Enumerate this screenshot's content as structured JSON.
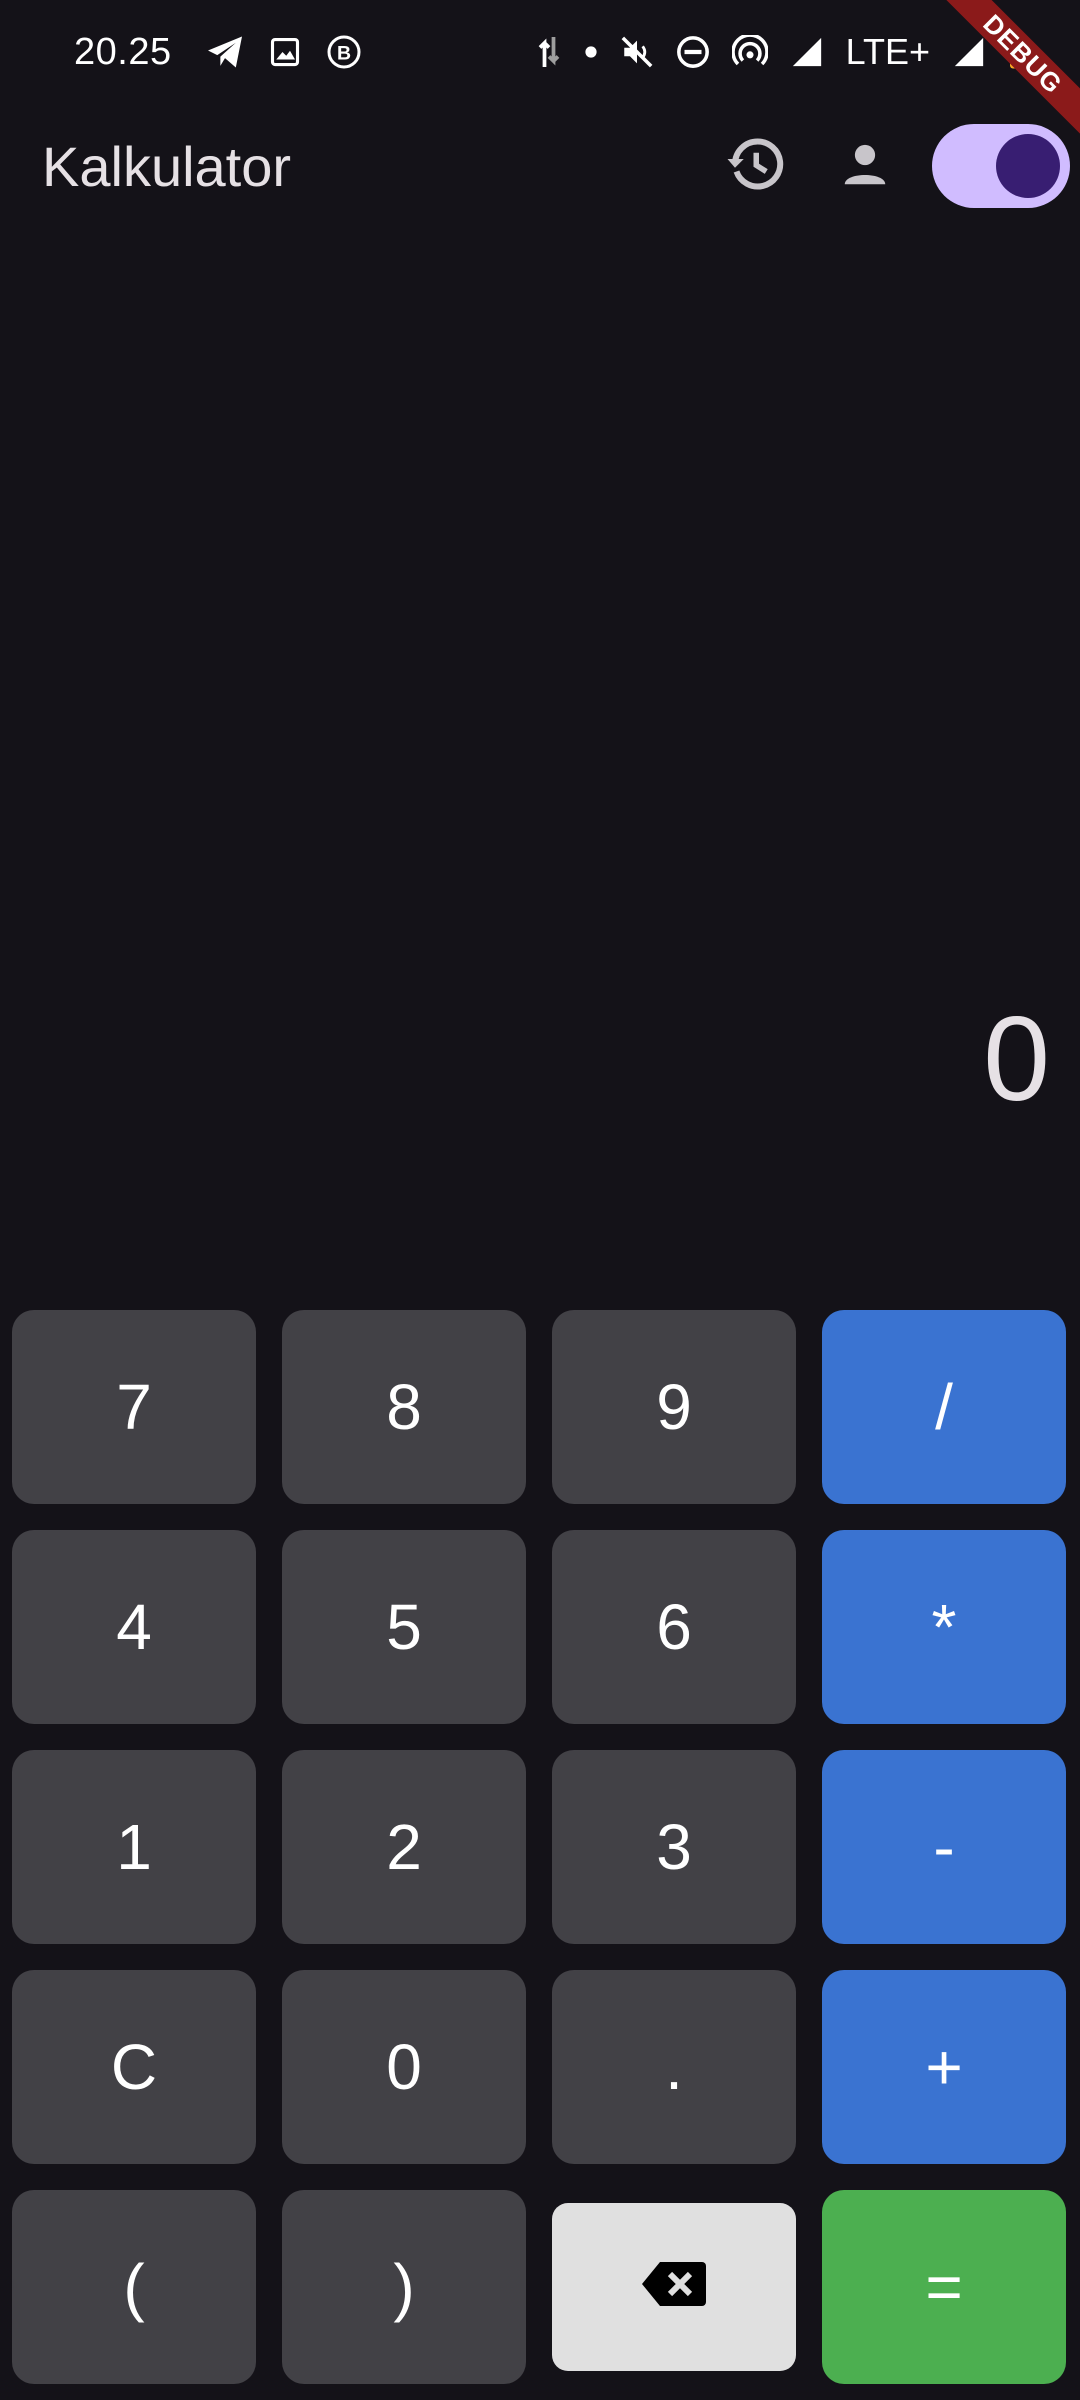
{
  "status_bar": {
    "time": "20.25",
    "network": "LTE+",
    "icons": [
      "telegram-icon",
      "gallery-icon",
      "b-badge-icon",
      "data-arrows-icon",
      "dot-icon",
      "mute-icon",
      "dnd-icon",
      "hotspot-icon",
      "signal-icon",
      "signal-icon-2",
      "battery-icon"
    ]
  },
  "debug_banner": {
    "label": "DEBUG"
  },
  "app_bar": {
    "title": "Kalkulator",
    "actions": [
      "history-icon",
      "account-icon",
      "theme-toggle"
    ],
    "toggle_on": true
  },
  "display": {
    "value": "0"
  },
  "keypad": {
    "rows": [
      [
        "7",
        "8",
        "9",
        "/"
      ],
      [
        "4",
        "5",
        "6",
        "*"
      ],
      [
        "1",
        "2",
        "3",
        "-"
      ],
      [
        "C",
        "0",
        ".",
        "+"
      ],
      [
        "(",
        ")",
        "backspace",
        "="
      ]
    ]
  },
  "colors": {
    "background": "#141218",
    "key": "#424146",
    "operator": "#3A73D1",
    "equals": "#4CAF50",
    "backspace": "#E0E0E0",
    "toggle_track": "#D0BCFF",
    "toggle_knob": "#381E72",
    "debug": "#8B1A1A"
  }
}
